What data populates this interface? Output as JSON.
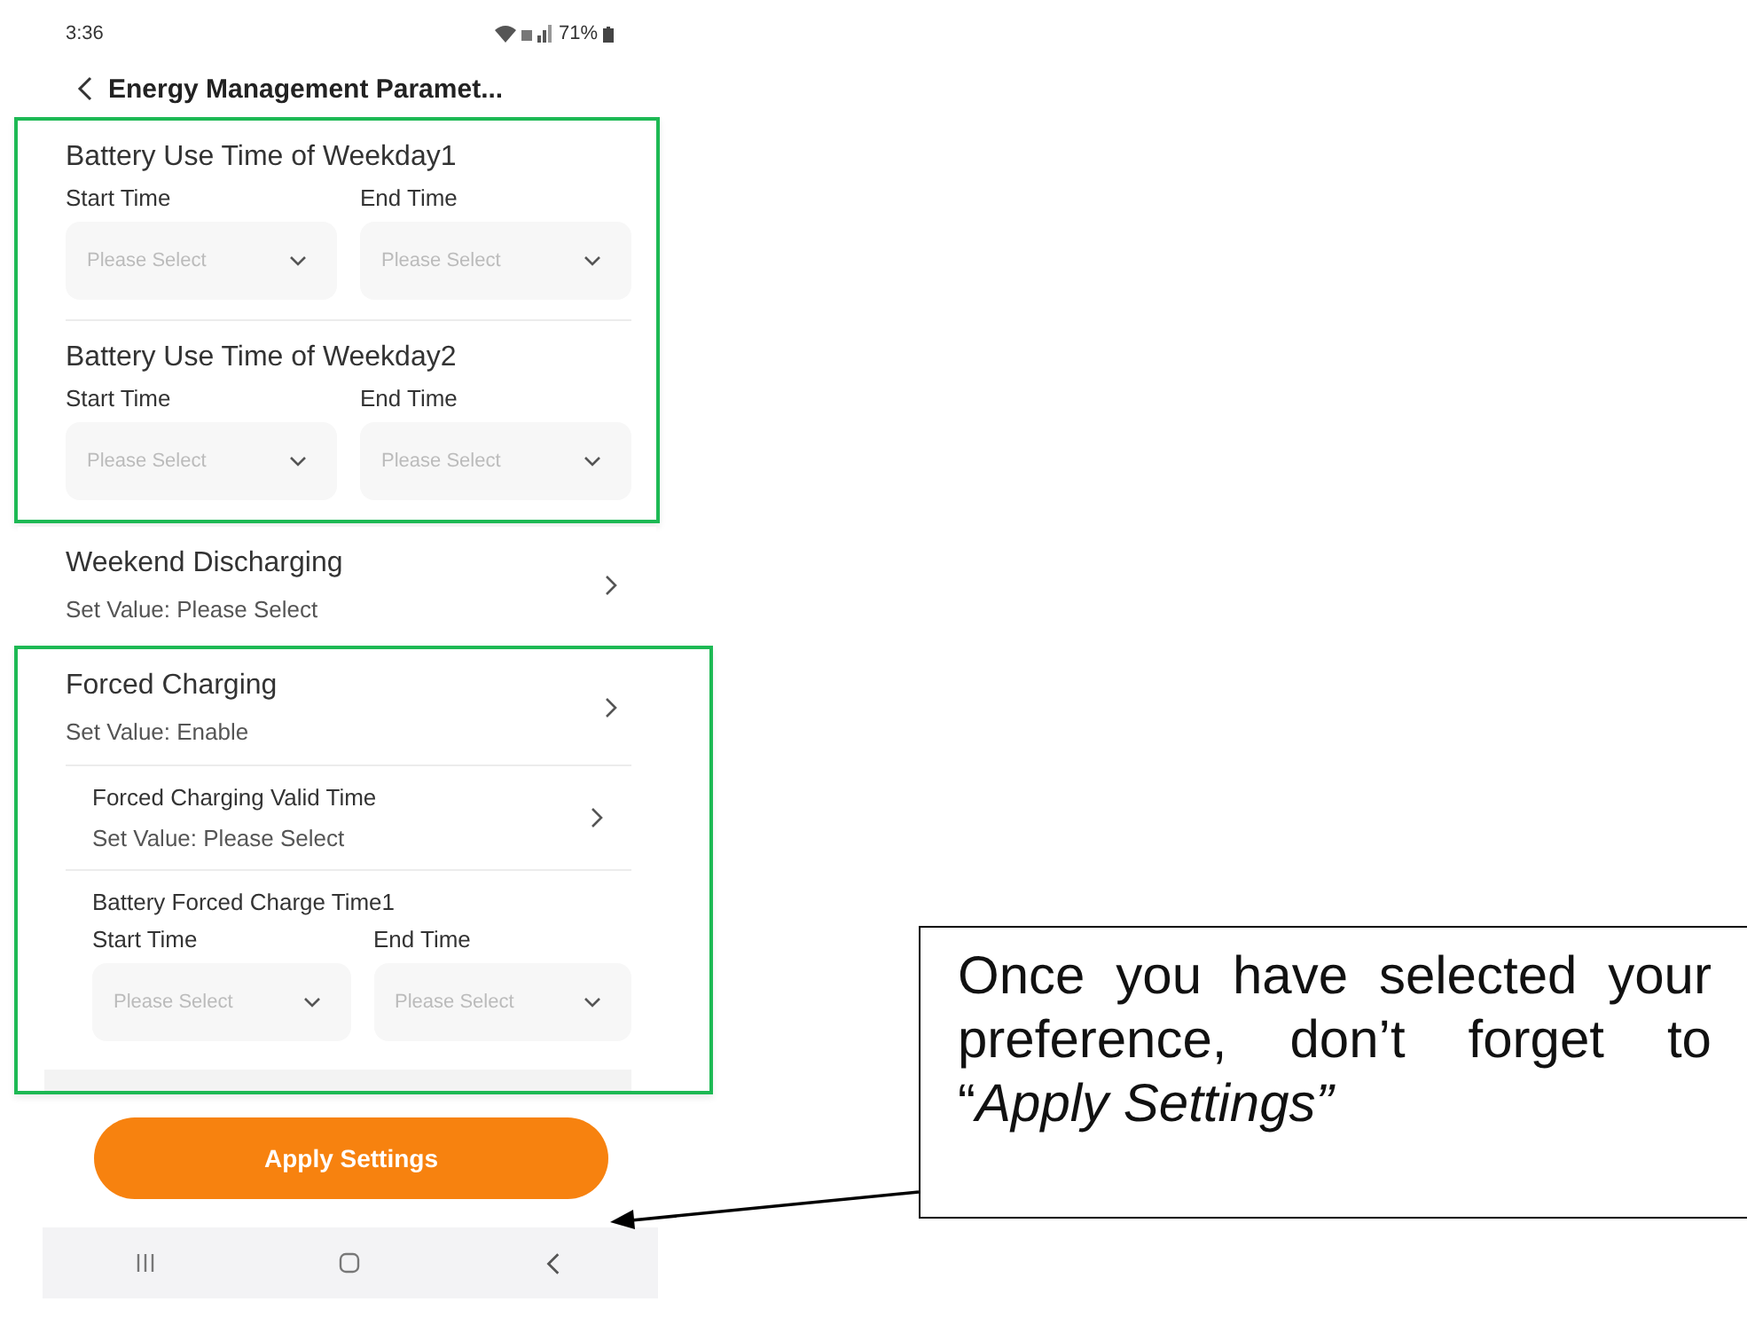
{
  "status_bar": {
    "time": "3:36",
    "battery": "71%"
  },
  "header": {
    "title": "Energy Management Paramet..."
  },
  "sections": [
    {
      "highlighted": true,
      "items": [
        {
          "kind": "time_range",
          "title": "Battery Use Time of Weekday1",
          "start_label": "Start Time",
          "end_label": "End Time",
          "start_placeholder": "Please Select",
          "end_placeholder": "Please Select"
        },
        {
          "kind": "time_range",
          "title": "Battery Use Time of Weekday2",
          "start_label": "Start Time",
          "end_label": "End Time",
          "start_placeholder": "Please Select",
          "end_placeholder": "Please Select"
        }
      ]
    },
    {
      "highlighted": false,
      "items": [
        {
          "kind": "setting",
          "title": "Weekend Discharging",
          "value": "Set Value: Please Select"
        }
      ]
    },
    {
      "highlighted": true,
      "items": [
        {
          "kind": "setting",
          "title": "Forced Charging",
          "value": "Set Value: Enable",
          "children": [
            {
              "kind": "setting",
              "title": "Forced Charging Valid Time",
              "value": "Set Value: Please Select"
            },
            {
              "kind": "time_range",
              "title": "Battery Forced Charge Time1",
              "start_label": "Start Time",
              "end_label": "End Time",
              "start_placeholder": "Please Select",
              "end_placeholder": "Please Select"
            }
          ]
        }
      ]
    }
  ],
  "apply_button": {
    "label": "Apply Settings"
  },
  "callout": {
    "text": "Once you have selected your preference, don’t forget to “*Apply Settings”*"
  }
}
